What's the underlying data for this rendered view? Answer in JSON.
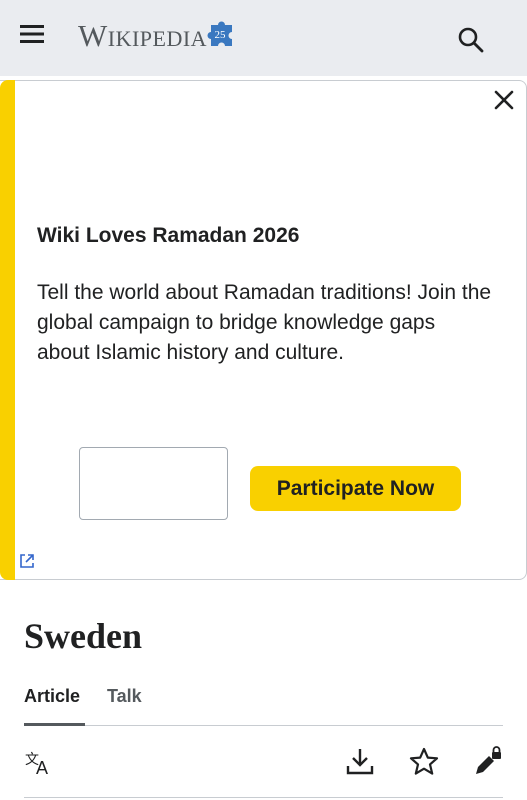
{
  "header": {
    "logo_text": "Wikipedia",
    "logo_badge": "25",
    "menu_icon": "hamburger-menu-icon",
    "search_icon": "search-icon"
  },
  "banner": {
    "accent_color": "#f9d000",
    "title": "Wiki Loves Ramadan 2026",
    "body": "Tell the world about Ramadan traditions! Join the global campaign to bridge knowledge gaps about Islamic history and culture.",
    "input_value": "",
    "button_label": "Participate Now",
    "close_icon": "close-icon",
    "external_link_icon": "external-link-icon"
  },
  "article": {
    "title": "Sweden",
    "tabs": [
      {
        "label": "Article",
        "selected": true
      },
      {
        "label": "Talk",
        "selected": false
      }
    ],
    "actions": {
      "language": "language-icon",
      "download": "download-icon",
      "watch": "star-icon",
      "edit": "edit-lock-icon"
    }
  }
}
